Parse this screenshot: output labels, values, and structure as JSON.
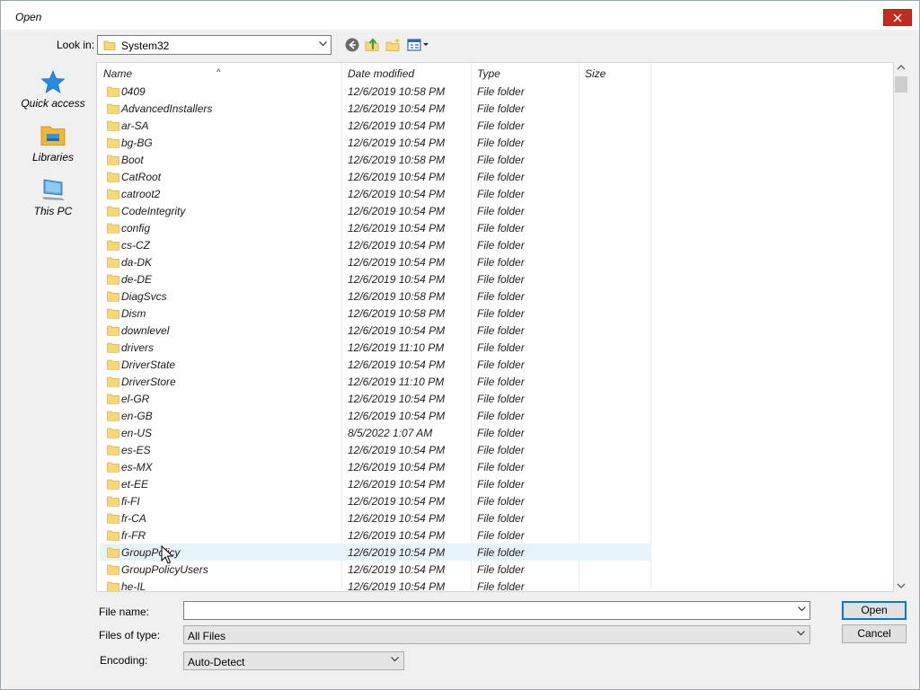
{
  "dialog": {
    "title": "Open"
  },
  "toolbar": {
    "look_in_label": "Look in:",
    "look_in_value": "System32",
    "icons": [
      "back-icon",
      "up-folder-icon",
      "new-folder-icon",
      "view-menu-icon"
    ]
  },
  "places": [
    {
      "label": "Quick access",
      "icon": "star-icon"
    },
    {
      "label": "Libraries",
      "icon": "libraries-icon"
    },
    {
      "label": "This PC",
      "icon": "computer-icon"
    }
  ],
  "columns": {
    "name": "Name",
    "date": "Date modified",
    "type": "Type",
    "size": "Size"
  },
  "files": [
    {
      "name": "0409",
      "date": "12/6/2019 10:58 PM",
      "type": "File folder"
    },
    {
      "name": "AdvancedInstallers",
      "date": "12/6/2019 10:54 PM",
      "type": "File folder"
    },
    {
      "name": "ar-SA",
      "date": "12/6/2019 10:54 PM",
      "type": "File folder"
    },
    {
      "name": "bg-BG",
      "date": "12/6/2019 10:54 PM",
      "type": "File folder"
    },
    {
      "name": "Boot",
      "date": "12/6/2019 10:58 PM",
      "type": "File folder"
    },
    {
      "name": "CatRoot",
      "date": "12/6/2019 10:54 PM",
      "type": "File folder"
    },
    {
      "name": "catroot2",
      "date": "12/6/2019 10:54 PM",
      "type": "File folder"
    },
    {
      "name": "CodeIntegrity",
      "date": "12/6/2019 10:54 PM",
      "type": "File folder"
    },
    {
      "name": "config",
      "date": "12/6/2019 10:54 PM",
      "type": "File folder"
    },
    {
      "name": "cs-CZ",
      "date": "12/6/2019 10:54 PM",
      "type": "File folder"
    },
    {
      "name": "da-DK",
      "date": "12/6/2019 10:54 PM",
      "type": "File folder"
    },
    {
      "name": "de-DE",
      "date": "12/6/2019 10:54 PM",
      "type": "File folder"
    },
    {
      "name": "DiagSvcs",
      "date": "12/6/2019 10:58 PM",
      "type": "File folder"
    },
    {
      "name": "Dism",
      "date": "12/6/2019 10:58 PM",
      "type": "File folder"
    },
    {
      "name": "downlevel",
      "date": "12/6/2019 10:54 PM",
      "type": "File folder"
    },
    {
      "name": "drivers",
      "date": "12/6/2019 11:10 PM",
      "type": "File folder"
    },
    {
      "name": "DriverState",
      "date": "12/6/2019 10:54 PM",
      "type": "File folder"
    },
    {
      "name": "DriverStore",
      "date": "12/6/2019 11:10 PM",
      "type": "File folder"
    },
    {
      "name": "el-GR",
      "date": "12/6/2019 10:54 PM",
      "type": "File folder"
    },
    {
      "name": "en-GB",
      "date": "12/6/2019 10:54 PM",
      "type": "File folder"
    },
    {
      "name": "en-US",
      "date": "8/5/2022 1:07 AM",
      "type": "File folder"
    },
    {
      "name": "es-ES",
      "date": "12/6/2019 10:54 PM",
      "type": "File folder"
    },
    {
      "name": "es-MX",
      "date": "12/6/2019 10:54 PM",
      "type": "File folder"
    },
    {
      "name": "et-EE",
      "date": "12/6/2019 10:54 PM",
      "type": "File folder"
    },
    {
      "name": "fi-FI",
      "date": "12/6/2019 10:54 PM",
      "type": "File folder"
    },
    {
      "name": "fr-CA",
      "date": "12/6/2019 10:54 PM",
      "type": "File folder"
    },
    {
      "name": "fr-FR",
      "date": "12/6/2019 10:54 PM",
      "type": "File folder"
    },
    {
      "name": "GroupPolicy",
      "date": "12/6/2019 10:54 PM",
      "type": "File folder",
      "hovered": true
    },
    {
      "name": "GroupPolicyUsers",
      "date": "12/6/2019 10:54 PM",
      "type": "File folder"
    },
    {
      "name": "he-IL",
      "date": "12/6/2019 10:54 PM",
      "type": "File folder"
    }
  ],
  "form": {
    "file_name_label": "File name:",
    "file_name_value": "",
    "file_type_label": "Files of type:",
    "file_type_value": "All Files",
    "encoding_label": "Encoding:",
    "encoding_value": "Auto-Detect"
  },
  "buttons": {
    "open": "Open",
    "cancel": "Cancel"
  },
  "colors": {
    "close_red": "#c42b1c",
    "folder_yellow": "#f8d775",
    "hover_row": "#e5f3fb",
    "default_button_border": "#0078d7"
  }
}
